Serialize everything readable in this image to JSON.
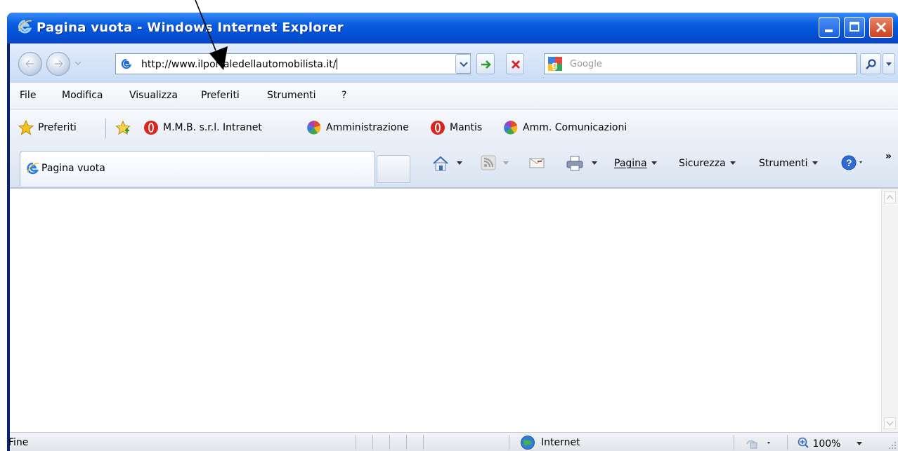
{
  "window": {
    "title": "Pagina vuota - Windows Internet Explorer"
  },
  "address_bar": {
    "url": "http://www.ilportaledellautomobilista.it/"
  },
  "search": {
    "placeholder": "Google"
  },
  "menu": {
    "items": [
      "File",
      "Modifica",
      "Visualizza",
      "Preferiti",
      "Strumenti",
      "?"
    ]
  },
  "favorites_bar": {
    "favorites_label": "Preferiti",
    "links": [
      "M.M.B. s.r.l. Intranet",
      "Amministrazione",
      "Mantis",
      "Amm. Comunicazioni"
    ]
  },
  "tabs": {
    "active_title": "Pagina vuota"
  },
  "command_bar": {
    "page_label": "Pagina",
    "security_label": "Sicurezza",
    "tools_label": "Strumenti",
    "overflow": "»"
  },
  "status_bar": {
    "status": "Fine",
    "zone": "Internet",
    "zoom": "100%"
  },
  "colors": {
    "title_bar": "#0350d6",
    "close_button": "#c9411e",
    "toolbar_bg": "#e2ecfb"
  }
}
